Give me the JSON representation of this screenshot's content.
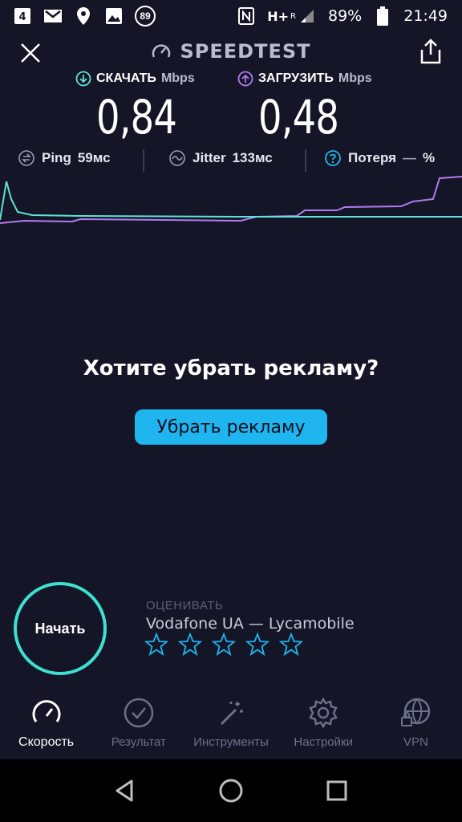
{
  "status_bar": {
    "badge": "89",
    "network": "H+",
    "roaming": "R",
    "battery": "89%",
    "time": "21:49"
  },
  "header": {
    "title": "SPEEDTEST"
  },
  "download": {
    "label": "СКАЧАТЬ",
    "unit": "Mbps",
    "value": "0,84",
    "color": "#5fe3d6"
  },
  "upload": {
    "label": "ЗАГРУЗИТЬ",
    "unit": "Mbps",
    "value": "0,48",
    "color": "#b07cf0"
  },
  "stats": {
    "ping_label": "Ping",
    "ping_value": "59мс",
    "jitter_label": "Jitter",
    "jitter_value": "133мс",
    "loss_label": "Потеря",
    "loss_value": "—",
    "loss_unit": "%"
  },
  "ad": {
    "title": "Хотите убрать рекламу?",
    "button": "Убрать рекламу"
  },
  "start": {
    "label": "Начать"
  },
  "rating": {
    "label": "ОЦЕНИВАТЬ",
    "provider": "Vodafone UA — Lycamobile",
    "stars": 5
  },
  "nav": {
    "items": [
      {
        "label": "Скорость",
        "icon": "speedometer-icon"
      },
      {
        "label": "Результат",
        "icon": "checkmark-circle-icon"
      },
      {
        "label": "Инструменты",
        "icon": "magic-wand-icon"
      },
      {
        "label": "Настройки",
        "icon": "gear-icon"
      },
      {
        "label": "VPN",
        "icon": "globe-lock-icon"
      }
    ]
  }
}
